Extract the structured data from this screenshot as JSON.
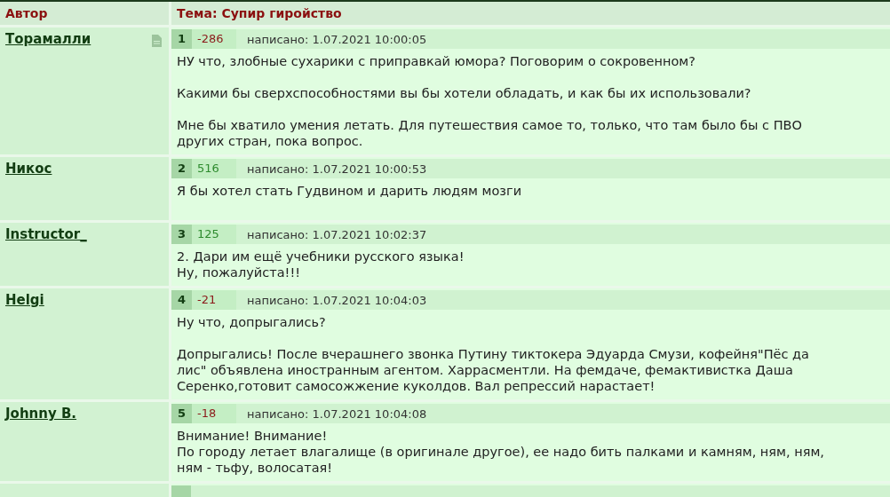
{
  "header": {
    "author_label": "Автор",
    "topic": "Тема: Супир гиройство"
  },
  "posts": [
    {
      "author": "Торамалли",
      "note_icon": true,
      "number": "1",
      "score": "-286",
      "color": "#8b1a1a",
      "posted": "написано: 1.07.2021 10:00:05",
      "paragraphs": [
        [
          "НУ что, злобные сухарики с приправкай юмора? Поговорим о сокровенном?"
        ],
        [
          "Какими бы сверхспособностями вы бы хотели обладать, и как бы их использовали?"
        ],
        [
          "Мне бы хватило умения летать. Для путешествия самое то, только, что там было бы с ПВО",
          "других стран, пока вопрос."
        ]
      ]
    },
    {
      "author": "Никос",
      "note_icon": false,
      "number": "2",
      "score": "516",
      "color": "#2e8b2e",
      "posted": "написано: 1.07.2021 10:00:53",
      "paragraphs": [
        [
          "Я бы хотел стать Гудвином и дарить людям мозги"
        ]
      ]
    },
    {
      "author": "Instructor_",
      "note_icon": false,
      "number": "3",
      "score": "125",
      "color": "#2e8b2e",
      "posted": "написано: 1.07.2021 10:02:37",
      "paragraphs": [
        [
          "2. Дари им ещё учебники русского языка!",
          "Ну, пожалуйста!!!"
        ]
      ]
    },
    {
      "author": "Helgi",
      "note_icon": false,
      "number": "4",
      "score": "-21",
      "color": "#8b1a1a",
      "posted": "написано: 1.07.2021 10:04:03",
      "paragraphs": [
        [
          "Ну что, допрыгались?"
        ],
        [
          "Допрыгались! После вчерашнего звонка Путину тиктокера Эдуарда Смузи, кофейня\"Пёс да",
          "лис\" объявлена иностранным агентом. Харрасментли. На фемдаче, фемактивистка Даша",
          "Серенко,готовит самосожжение куколдов. Вал репрессий нарастает!"
        ]
      ]
    },
    {
      "author": "Johnny B.",
      "note_icon": false,
      "number": "5",
      "score": "-18",
      "color": "#8b1a1a",
      "posted": "написано: 1.07.2021 10:04:08",
      "paragraphs": [
        [
          "Внимание! Внимание!",
          "По городу летает влагалище (в оригинале другое), ее надо бить палками и камням, ням, ням,",
          "ням - тьфу, волосатая!"
        ]
      ]
    }
  ]
}
